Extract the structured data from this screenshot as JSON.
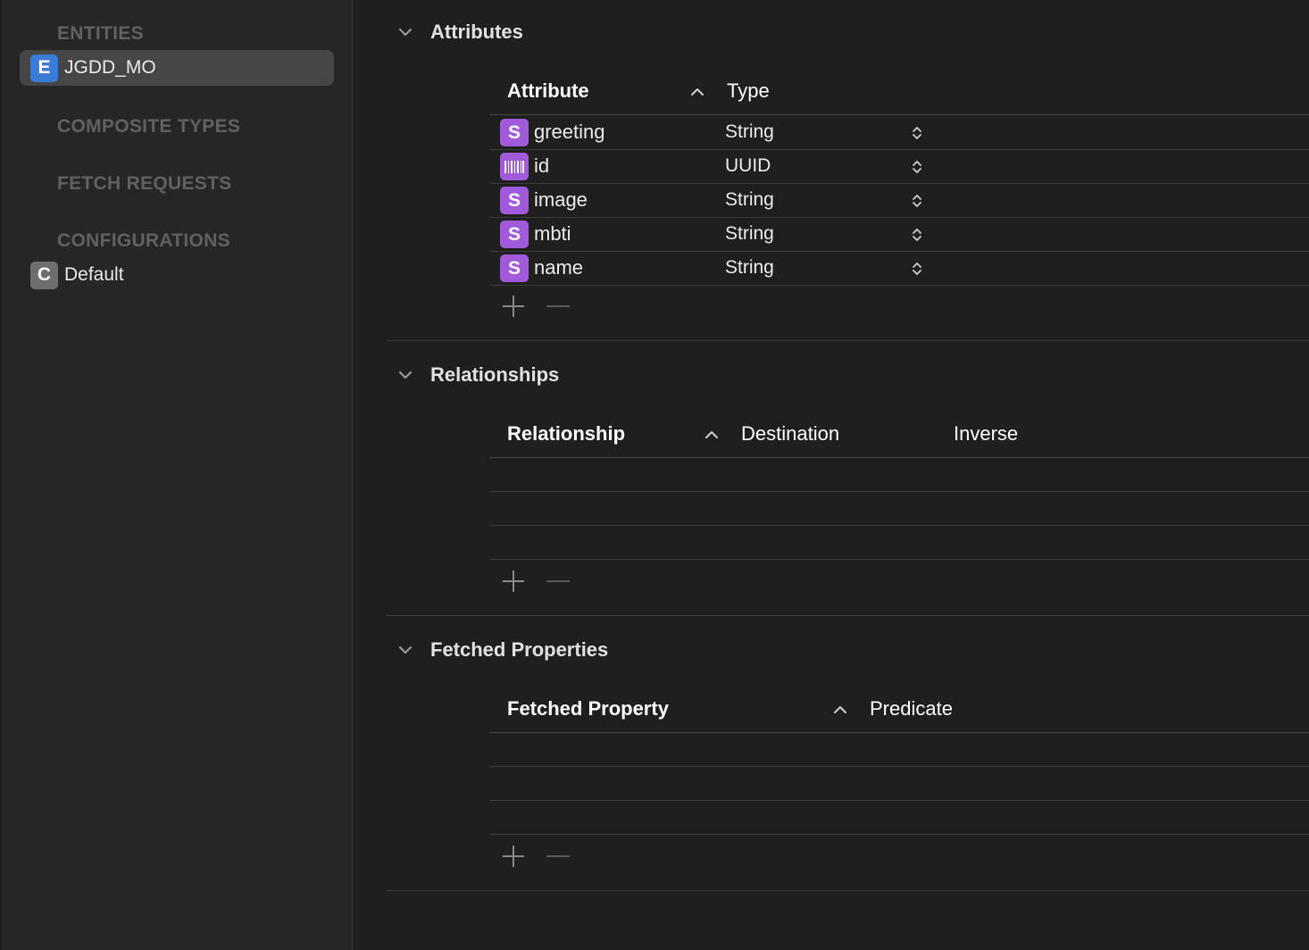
{
  "sidebar": {
    "entities_header": "ENTITIES",
    "entities": [
      {
        "badge": "E",
        "label": "JGDD_MO",
        "selected": true
      }
    ],
    "composite_header": "COMPOSITE TYPES",
    "fetch_header": "FETCH REQUESTS",
    "configurations_header": "CONFIGURATIONS",
    "configurations": [
      {
        "badge": "C",
        "label": "Default"
      }
    ]
  },
  "attributes": {
    "title": "Attributes",
    "col_attribute": "Attribute",
    "col_type": "Type",
    "rows": [
      {
        "icon": "string-type-icon",
        "badge": "S",
        "name": "greeting",
        "type": "String"
      },
      {
        "icon": "uuid-type-icon",
        "badge": "",
        "name": "id",
        "type": "UUID"
      },
      {
        "icon": "string-type-icon",
        "badge": "S",
        "name": "image",
        "type": "String"
      },
      {
        "icon": "string-type-icon",
        "badge": "S",
        "name": "mbti",
        "type": "String"
      },
      {
        "icon": "string-type-icon",
        "badge": "S",
        "name": "name",
        "type": "String"
      }
    ]
  },
  "relationships": {
    "title": "Relationships",
    "col_relationship": "Relationship",
    "col_destination": "Destination",
    "col_inverse": "Inverse"
  },
  "fetched_properties": {
    "title": "Fetched Properties",
    "col_fetched_property": "Fetched Property",
    "col_predicate": "Predicate"
  },
  "colors": {
    "entity_badge": "#3a7bd5",
    "config_badge": "#6e6e6e",
    "attribute_badge": "#a15ad9",
    "selected_row": "#464646"
  }
}
